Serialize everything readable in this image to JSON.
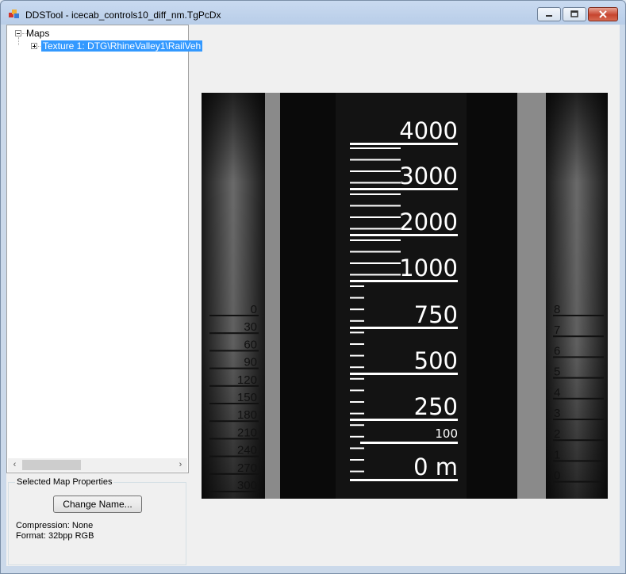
{
  "window": {
    "title": "DDSTool - icecab_controls10_diff_nm.TgPcDx"
  },
  "tree": {
    "root_label": "Maps",
    "child_label": "Texture 1: DTG\\RhineValley1\\RailVeh"
  },
  "properties": {
    "group_label": "Selected Map Properties",
    "change_name_button": "Change Name...",
    "compression": "Compression: None",
    "format": "Format: 32bpp RGB"
  },
  "texture": {
    "left_gauge": [
      "0",
      "30",
      "60",
      "90",
      "120",
      "150",
      "180",
      "210",
      "240",
      "270",
      "300"
    ],
    "right_gauge": [
      "8",
      "7",
      "6",
      "5",
      "4",
      "3",
      "2",
      "1",
      "0"
    ],
    "altimeter": [
      "4000",
      "3000",
      "2000",
      "1000",
      "750",
      "500",
      "250",
      "100",
      "0 m"
    ]
  },
  "colors": {
    "selection": "#3399ff",
    "window_frame": "#b8cde8",
    "close_button": "#c7452f"
  }
}
